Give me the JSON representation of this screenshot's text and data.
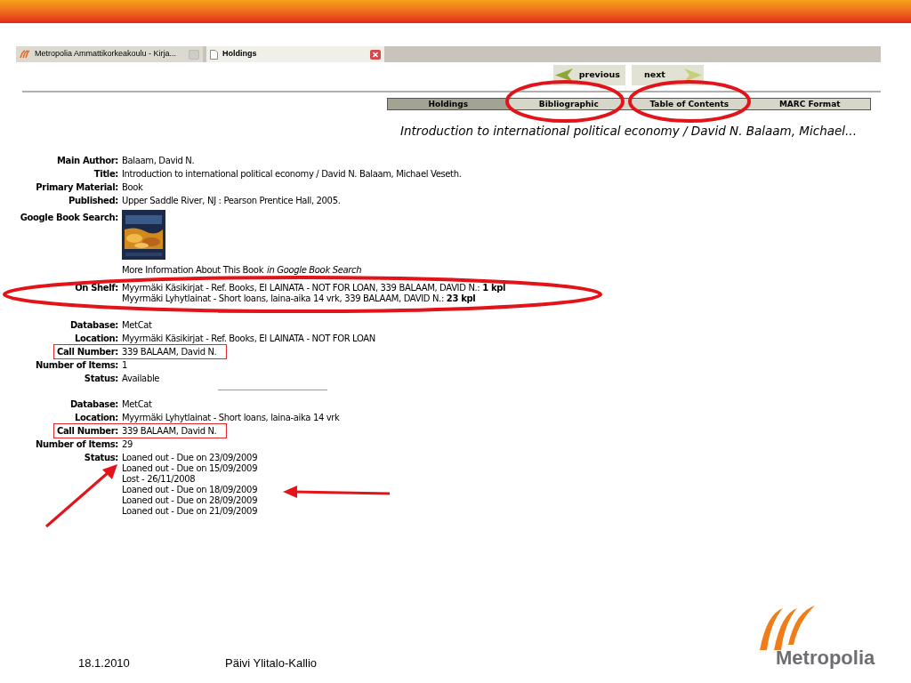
{
  "browser_tabs": [
    {
      "title": "Metropolia Ammattikorkeakoulu - Kirja...",
      "selected": false
    },
    {
      "title": "Holdings",
      "selected": true
    }
  ],
  "nav_buttons": [
    {
      "label": "previous",
      "kind": "back"
    },
    {
      "label": "next",
      "kind": "forward"
    }
  ],
  "record_tabs": [
    {
      "label": "Holdings",
      "selected": true
    },
    {
      "label": "Bibliographic",
      "selected": false
    },
    {
      "label": "Table of Contents",
      "selected": false
    },
    {
      "label": "MARC Format",
      "selected": false
    }
  ],
  "record_title": "Introduction to international political economy / David N. Balaam, Michael...",
  "fields": [
    {
      "label": "Main Author:",
      "value": "Balaam, David N."
    },
    {
      "label": "Title:",
      "value": "Introduction to international political economy / David N. Balaam, Michael Veseth."
    },
    {
      "label": "Primary Material:",
      "value": "Book"
    },
    {
      "label": "Published:",
      "value": "Upper Saddle River, NJ : Pearson Prentice Hall, 2005."
    }
  ],
  "google_book_search": {
    "label": "Google Book Search:",
    "link": "More Information About This Book",
    "link_suffix": "in Google Book Search"
  },
  "on_shelf": {
    "label": "On Shelf:",
    "lines": [
      "Myyrmäki Käsikirjat - Ref. Books, EI LAINATA - NOT FOR LOAN, 339 BALAAM, DAVID N.: **1 kpl**",
      "Myyrmäki Lyhytlainat - Short loans, laina-aika 14 vrk, 339 BALAAM, DAVID N.: **23 kpl**"
    ]
  },
  "holdings": [
    {
      "fields": [
        {
          "label": "Database:",
          "value": "MetCat",
          "boxed": false
        },
        {
          "label": "Location:",
          "value": "Myyrmäki Käsikirjat - Ref. Books, EI LAINATA - NOT FOR LOAN",
          "boxed": false
        },
        {
          "label": "Call Number:",
          "value": "339 BALAAM, David N.",
          "boxed": true
        },
        {
          "label": "Number of Items:",
          "value": "1",
          "boxed": false
        }
      ],
      "status_label": "Status:",
      "status": [
        "Available"
      ]
    },
    {
      "fields": [
        {
          "label": "Database:",
          "value": "MetCat",
          "boxed": false
        },
        {
          "label": "Location:",
          "value": "Myyrmäki Lyhytlainat - Short loans, laina-aika 14 vrk",
          "boxed": false
        },
        {
          "label": "Call Number:",
          "value": "339 BALAAM, David N.",
          "boxed": true
        },
        {
          "label": "Number of Items:",
          "value": "29",
          "boxed": false
        }
      ],
      "status_label": "Status:",
      "status": [
        "Loaned out - Due on 23/09/2009",
        "Loaned out - Due on 15/09/2009",
        "Lost - 26/11/2008",
        "Loaned out - Due on 18/09/2009",
        "Loaned out - Due on 28/09/2009",
        "Loaned out - Due on 21/09/2009"
      ]
    }
  ],
  "footer": {
    "date": "18.1.2010",
    "author": "Päivi Ylitalo-Kallio",
    "logo_text": "Metropolia"
  }
}
